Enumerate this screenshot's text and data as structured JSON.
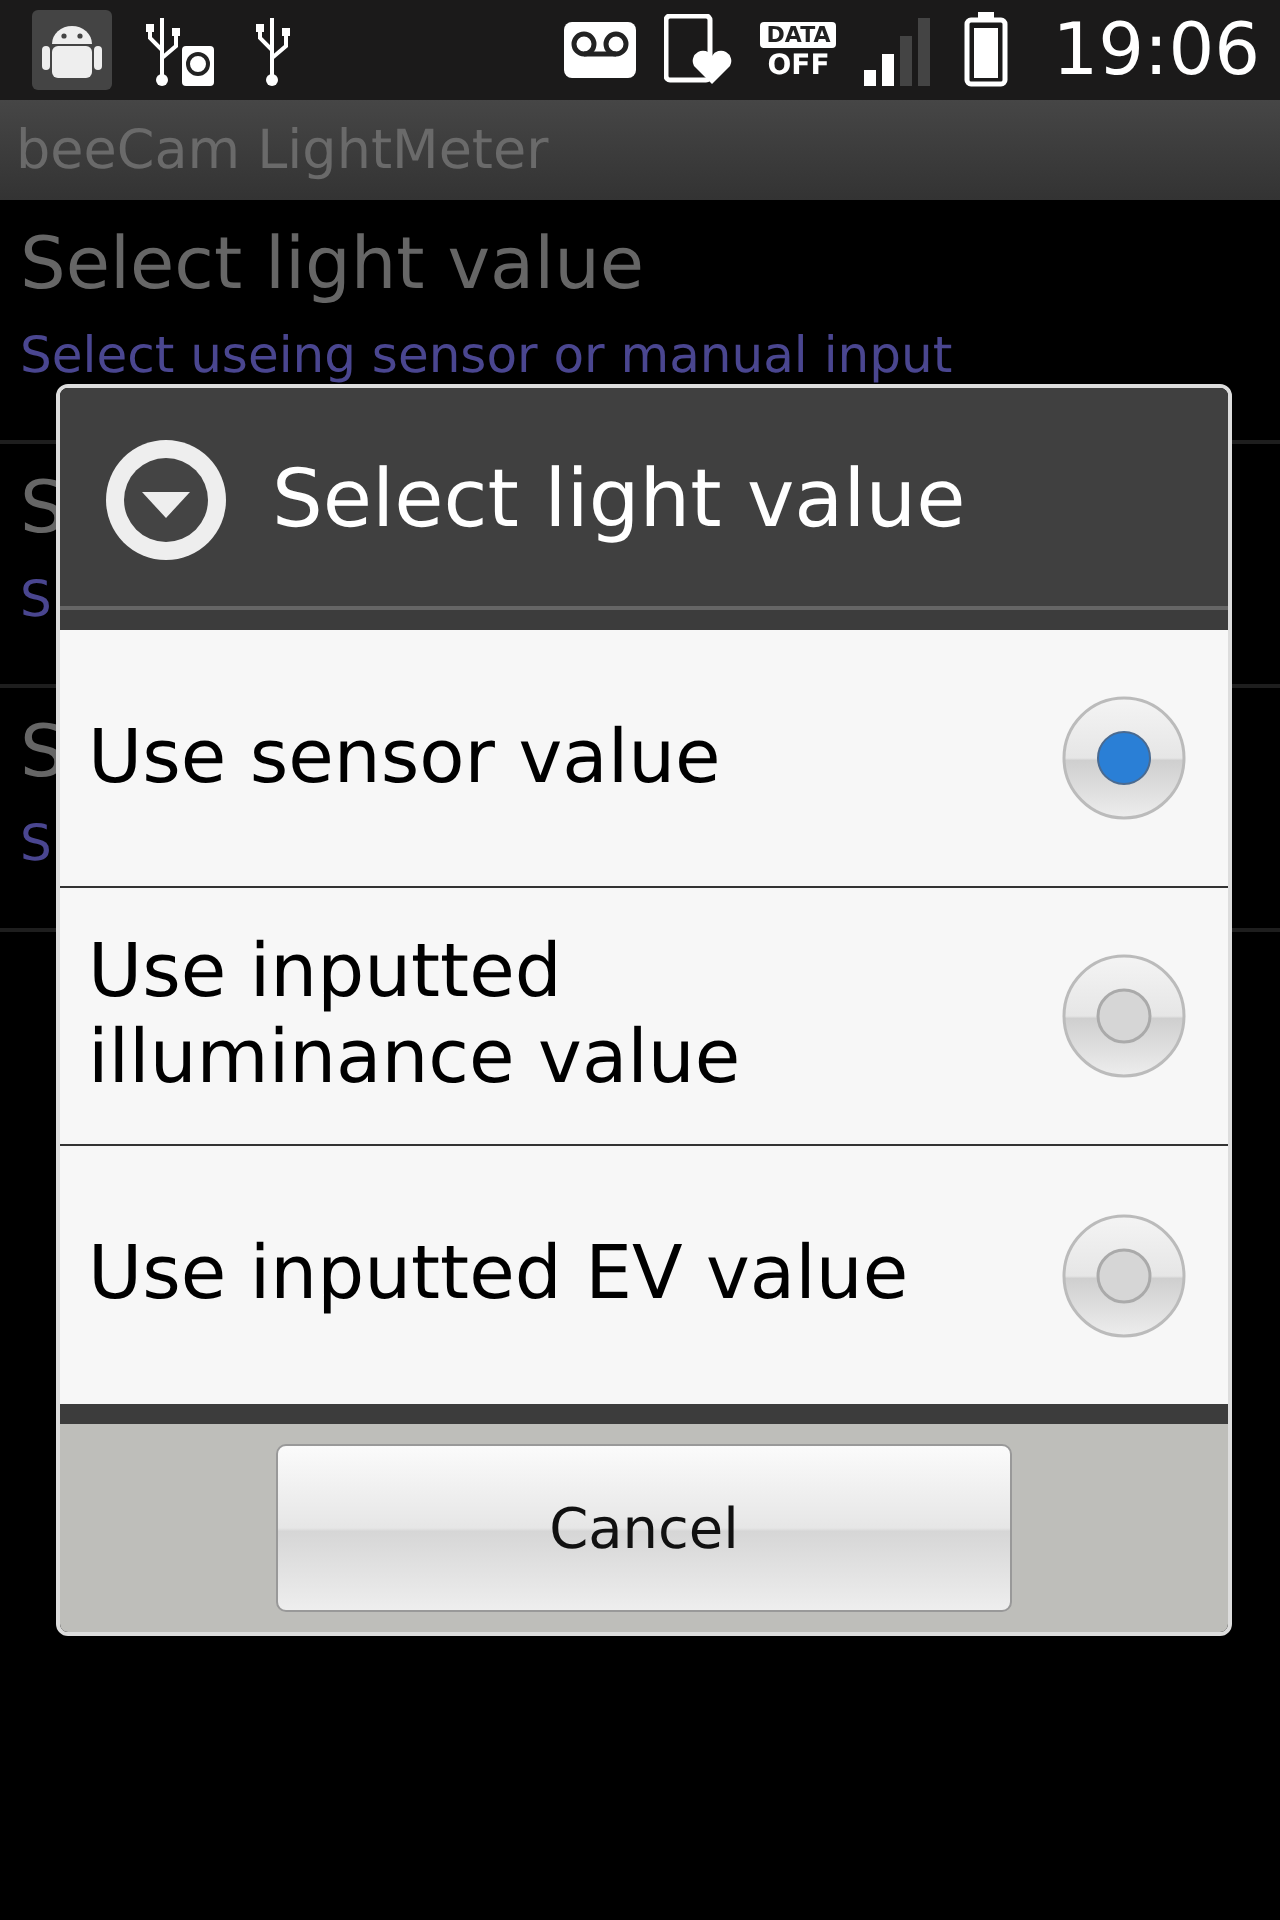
{
  "status_bar": {
    "data_badge": {
      "top": "DATA",
      "bottom": "OFF"
    },
    "time": "19:06"
  },
  "app_bar": {
    "title": "beeCam LightMeter"
  },
  "preferences": [
    {
      "title": "Select light value",
      "summary": "Select useing sensor or manual input"
    },
    {
      "title": "S",
      "summary": "S"
    },
    {
      "title": "S",
      "summary": "S"
    }
  ],
  "dialog": {
    "title": "Select light value",
    "options": [
      {
        "label": "Use sensor value",
        "selected": true
      },
      {
        "label": "Use inputted illuminance value",
        "selected": false
      },
      {
        "label": "Use inputted EV value",
        "selected": false
      }
    ],
    "buttons": [
      "Cancel"
    ]
  }
}
